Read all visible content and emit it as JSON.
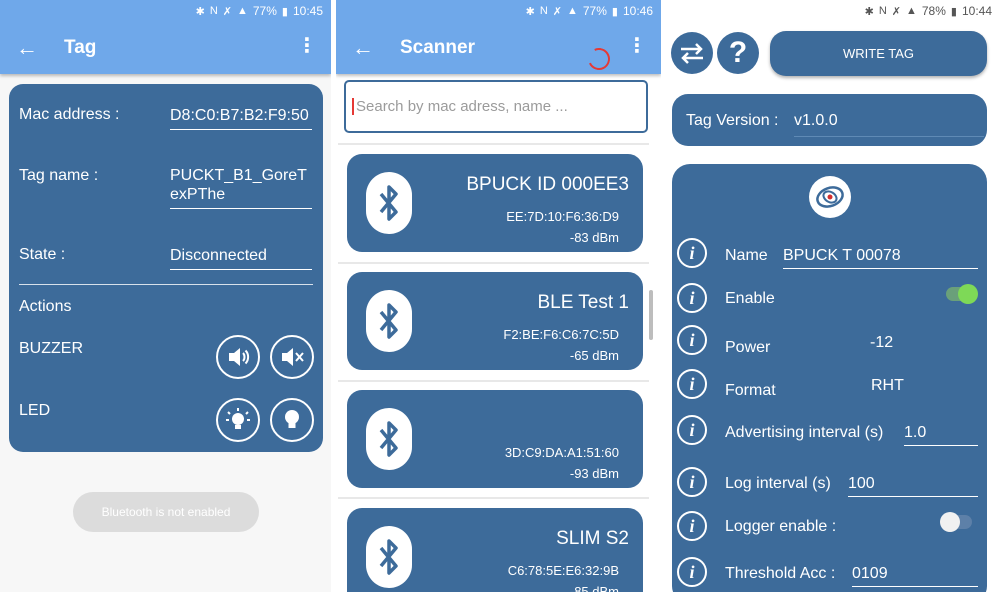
{
  "screen1": {
    "status": {
      "battery": "77%",
      "time": "10:45"
    },
    "title": "Tag",
    "mac_label": "Mac address :",
    "mac_value": "D8:C0:B7:B2:F9:50",
    "name_label": "Tag name :",
    "name_value": "PUCKT_B1_GoreTexPThe",
    "state_label": "State :",
    "state_value": "Disconnected",
    "actions_label": "Actions",
    "buzzer_label": "BUZZER",
    "led_label": "LED",
    "toast": "Bluetooth is not enabled"
  },
  "screen2": {
    "status": {
      "battery": "77%",
      "time": "10:46"
    },
    "title": "Scanner",
    "search_placeholder": "Search by mac adress, name ...",
    "devices": [
      {
        "name": "BPUCK ID 000EE3",
        "mac": "EE:7D:10:F6:36:D9",
        "rssi": "-83 dBm"
      },
      {
        "name": "BLE Test 1",
        "mac": "F2:BE:F6:C6:7C:5D",
        "rssi": "-65 dBm"
      },
      {
        "name": "",
        "mac": "3D:C9:DA:A1:51:60",
        "rssi": "-93 dBm"
      },
      {
        "name": "SLIM S2",
        "mac": "C6:78:5E:E6:32:9B",
        "rssi": "-85 dBm"
      }
    ]
  },
  "screen3": {
    "status": {
      "battery": "78%",
      "time": "10:44"
    },
    "write_label": "WRITE TAG",
    "version_label": "Tag Version :",
    "version_value": "v1.0.0",
    "fields": {
      "name_label": "Name",
      "name_value": "BPUCK T 00078",
      "enable_label": "Enable",
      "power_label": "Power",
      "power_value": "-12",
      "format_label": "Format",
      "format_value": "RHT",
      "adv_label": "Advertising interval (s)",
      "adv_value": "1.0",
      "log_label": "Log interval (s)",
      "log_value": "100",
      "logger_label": "Logger enable :",
      "threshold_label": "Threshold Acc :",
      "threshold_value": "0109"
    }
  }
}
